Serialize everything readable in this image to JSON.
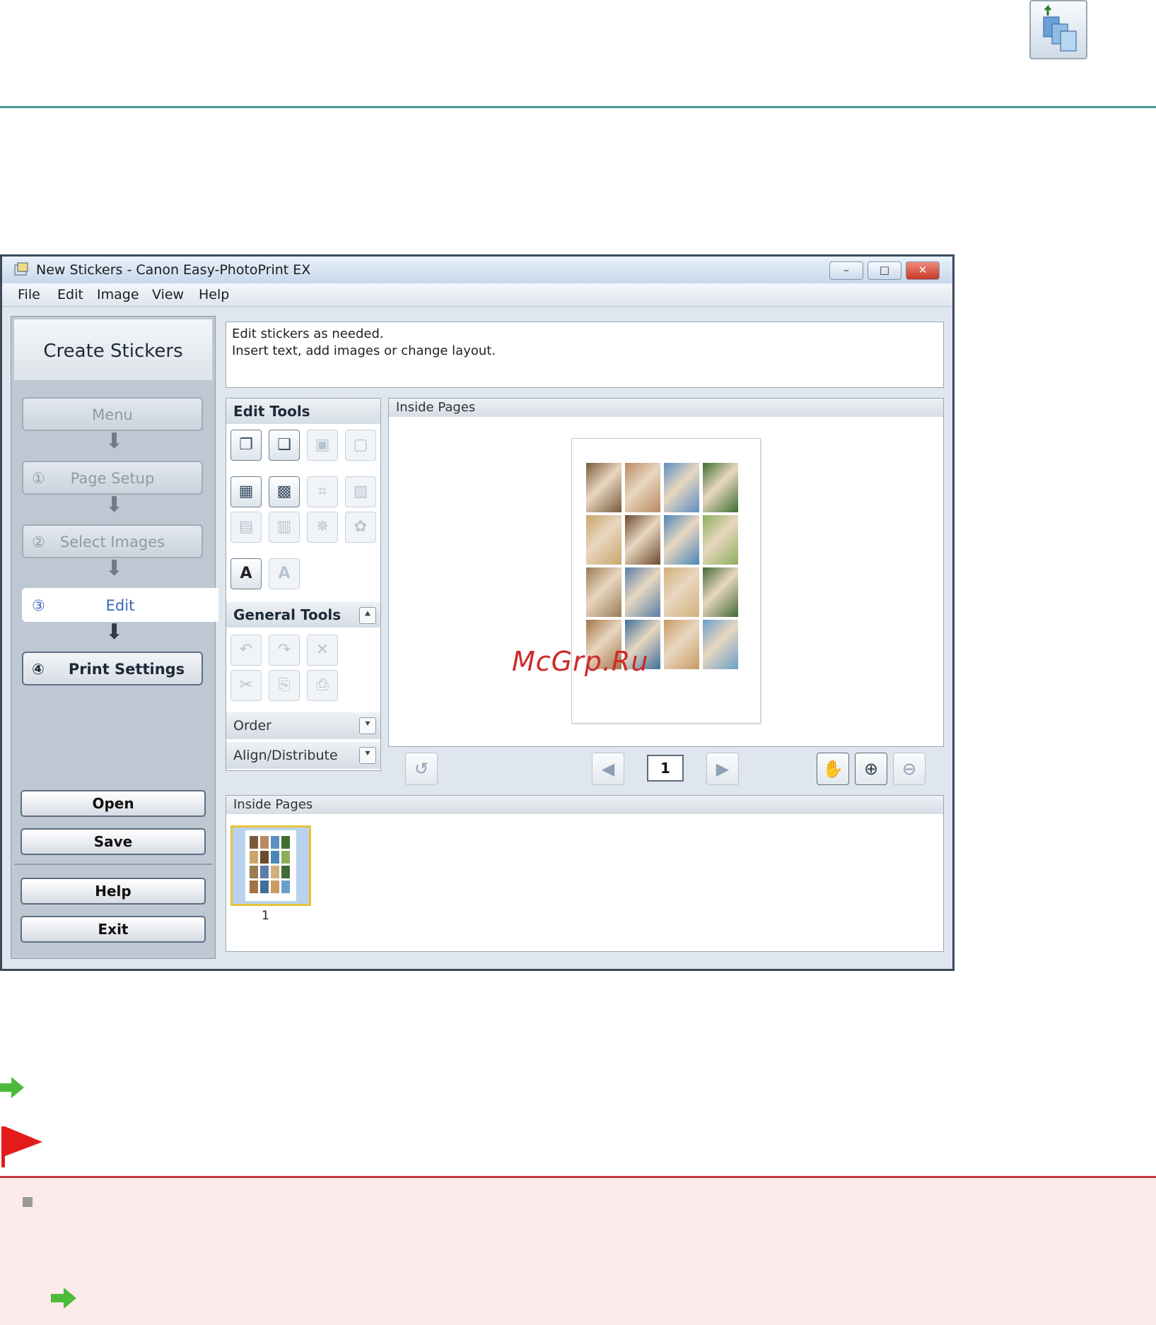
{
  "window": {
    "title": "New Stickers - Canon Easy-PhotoPrint EX",
    "controls": [
      "–",
      "□",
      "✕"
    ]
  },
  "menubar": [
    "File",
    "Edit",
    "Image",
    "View",
    "Help"
  ],
  "sidebar": {
    "title": "Create Stickers",
    "steps": [
      {
        "num": "",
        "label": "Menu"
      },
      {
        "num": "①",
        "label": "Page Setup"
      },
      {
        "num": "②",
        "label": "Select Images"
      },
      {
        "num": "③",
        "label": "Edit"
      },
      {
        "num": "④",
        "label": "Print Settings"
      }
    ],
    "buttons": {
      "open": "Open",
      "save": "Save",
      "help": "Help",
      "exit": "Exit"
    }
  },
  "instructions": {
    "line1": "Edit stickers as needed.",
    "line2": "Insert text, add images or change layout."
  },
  "tools": {
    "edit_tools": "Edit Tools",
    "general_tools": "General Tools",
    "order": "Order",
    "align": "Align/Distribute"
  },
  "preview": {
    "header": "Inside Pages",
    "page_number": "1"
  },
  "thumbnails": {
    "header": "Inside Pages",
    "items": [
      "1"
    ]
  },
  "watermark": "McGrp.Ru",
  "colors": {
    "accent_rule": "#4a9a94",
    "note_border": "#c53a3a",
    "note_bg": "#fdeaea",
    "selection": "#e6c23a"
  }
}
